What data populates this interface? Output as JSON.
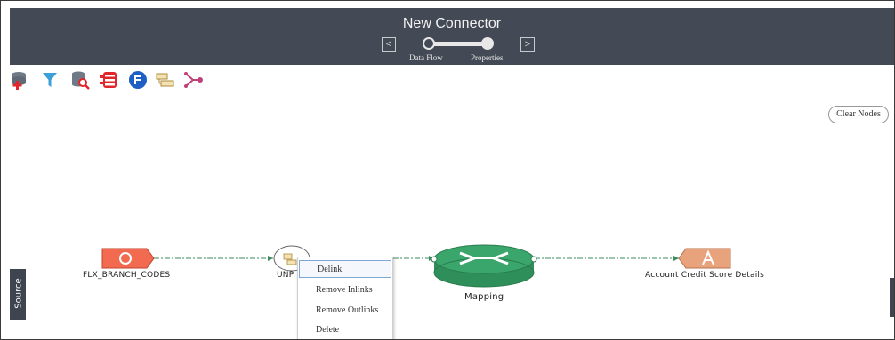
{
  "header": {
    "title": "New Connector",
    "prev_icon": "<",
    "next_icon": ">",
    "steps": [
      {
        "label": "Data Flow"
      },
      {
        "label": "Properties"
      }
    ]
  },
  "toolbar": {
    "tools": [
      {
        "icon": "add-datastore-icon"
      },
      {
        "icon": "filter-icon"
      },
      {
        "icon": "search-datastore-icon"
      },
      {
        "icon": "table-list-icon"
      },
      {
        "icon": "transform-circle-icon"
      },
      {
        "icon": "hierarchy-icon"
      },
      {
        "icon": "split-join-icon"
      }
    ]
  },
  "actions": {
    "clear_nodes": "Clear Nodes"
  },
  "nodes": {
    "source": {
      "letter": "O",
      "label": "FLX_BRANCH_CODES",
      "color": "#f26a4f"
    },
    "unpivot": {
      "label": "UNP"
    },
    "mapping": {
      "label": "Mapping",
      "color": "#3aa66b"
    },
    "target": {
      "letter": "A",
      "label": "Account Credit Score Details",
      "color": "#e8a27c"
    }
  },
  "context_menu": {
    "items": [
      "Delink",
      "Remove Inlinks",
      "Remove Outlinks",
      "Delete"
    ]
  },
  "side_panel": {
    "source_label": "Source"
  },
  "colors": {
    "header_bg": "#444a55",
    "link_line": "#2e8b57"
  }
}
